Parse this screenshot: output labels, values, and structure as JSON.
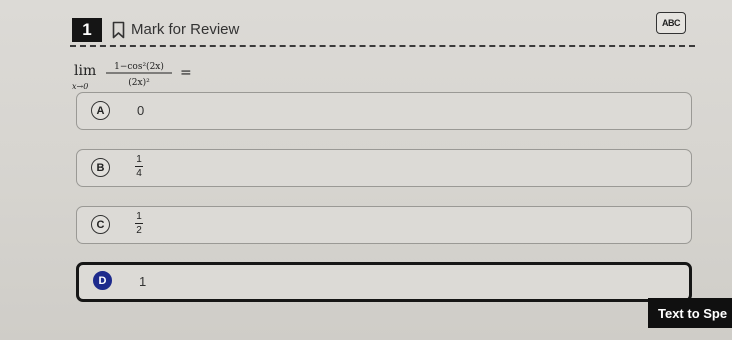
{
  "header": {
    "question_number": "1",
    "mark_for_review_label": "Mark for Review",
    "abc_button_label": "ABC"
  },
  "question": {
    "lim": "lim",
    "lim_sub": "x→0",
    "numerator": "1−cos²(2x)",
    "denominator": "(2x)²",
    "equals": "="
  },
  "options": [
    {
      "letter": "A",
      "value": "0"
    },
    {
      "letter": "B",
      "numerator": "1",
      "denominator": "4"
    },
    {
      "letter": "C",
      "numerator": "1",
      "denominator": "2"
    },
    {
      "letter": "D",
      "value": "1",
      "selected": true
    }
  ],
  "text_to_speech": "Text to Spe",
  "colors": {
    "selected_badge": "#1d2a8c",
    "question_number_bg": "#151515",
    "tts_bg": "#101010"
  }
}
